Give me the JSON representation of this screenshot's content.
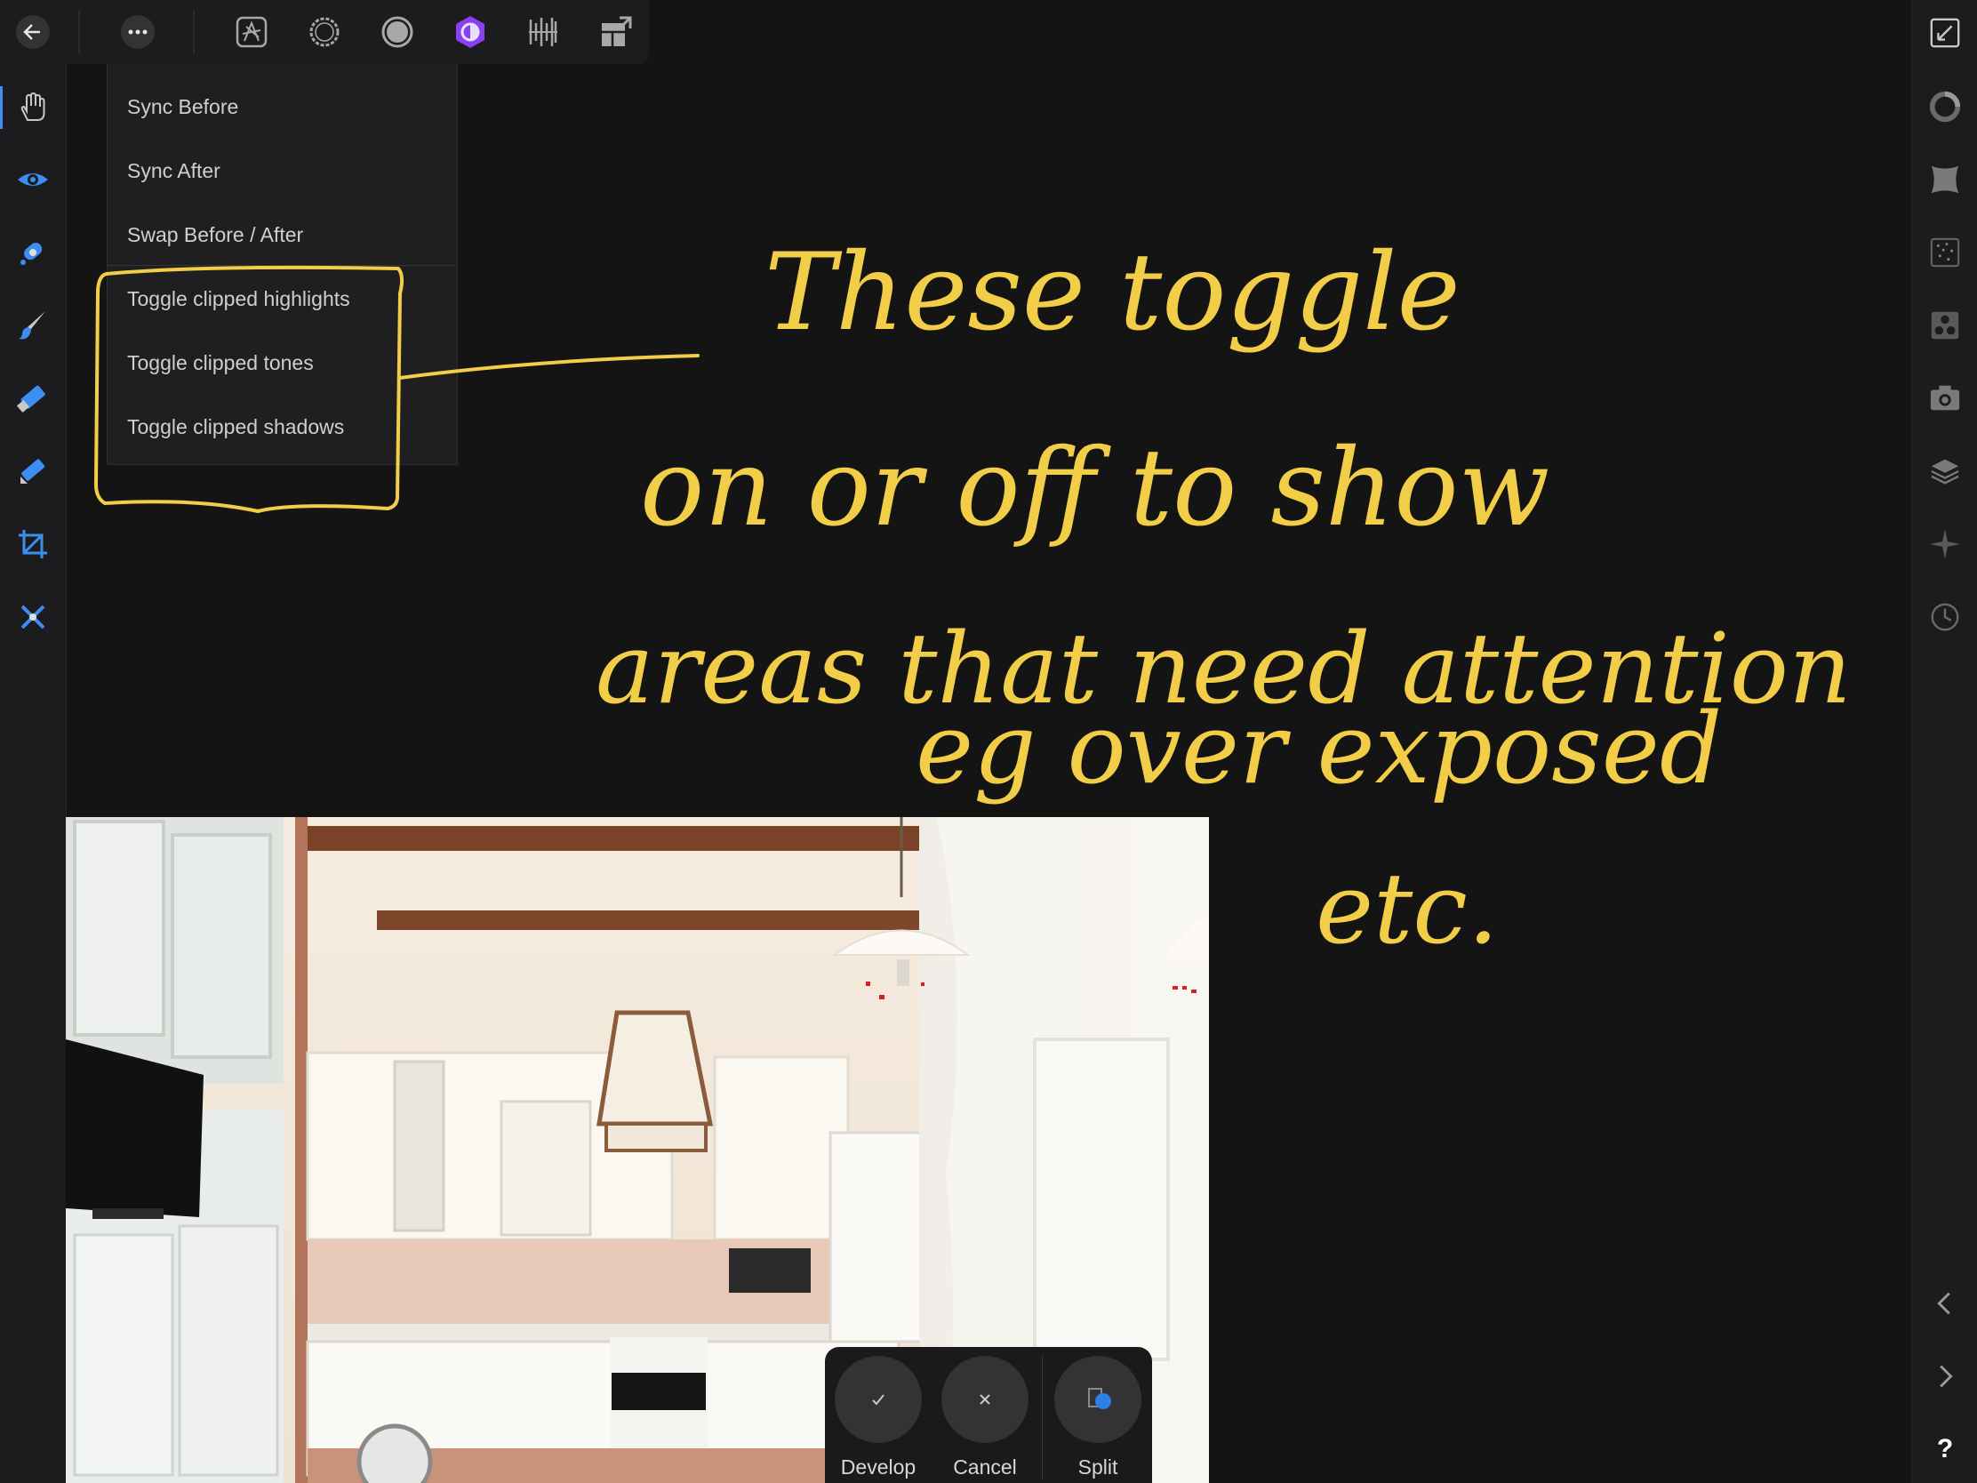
{
  "top_toolbar": {
    "back_icon": "back-arrow-icon",
    "more_icon": "ellipsis-icon",
    "personas": [
      "photo-persona-icon",
      "liquify-persona-icon",
      "develop-persona-icon",
      "tone-mapping-persona-icon",
      "export-persona-icon",
      "layout-persona-icon"
    ],
    "active_persona": "tone-mapping-persona-icon",
    "accent_color": "#8a3ff0"
  },
  "menu": {
    "items": [
      {
        "label": "Sync Before"
      },
      {
        "label": "Sync After"
      },
      {
        "label": "Swap Before / After"
      },
      {
        "label": "Toggle clipped highlights"
      },
      {
        "label": "Toggle clipped tones"
      },
      {
        "label": "Toggle clipped shadows"
      }
    ]
  },
  "left_toolbar": {
    "tools": [
      "hand-tool-icon",
      "red-eye-tool-icon",
      "blemish-tool-icon",
      "brush-tool-icon",
      "erase-tool-icon",
      "gradient-tool-icon",
      "crop-tool-icon",
      "white-balance-tool-icon"
    ],
    "active_tool": "hand-tool-icon",
    "tool_color": "#3d8ef2"
  },
  "right_toolbar": {
    "items": [
      "fit-view-icon",
      "basic-panel-icon",
      "lens-panel-icon",
      "details-panel-icon",
      "tones-panel-icon",
      "overlays-panel-icon",
      "layers-panel-icon",
      "focus-panel-icon",
      "history-panel-icon",
      "prev-arrow-icon",
      "next-arrow-icon",
      "help-icon"
    ],
    "help_label": "?"
  },
  "bottom_panel": {
    "develop_label": "Develop",
    "cancel_label": "Cancel",
    "split_label": "Split"
  },
  "annotation": {
    "color": "#f2cd48",
    "lines": [
      "These toggle",
      "on or off to show",
      "areas that need attention",
      "eg over exposed",
      "etc."
    ]
  }
}
